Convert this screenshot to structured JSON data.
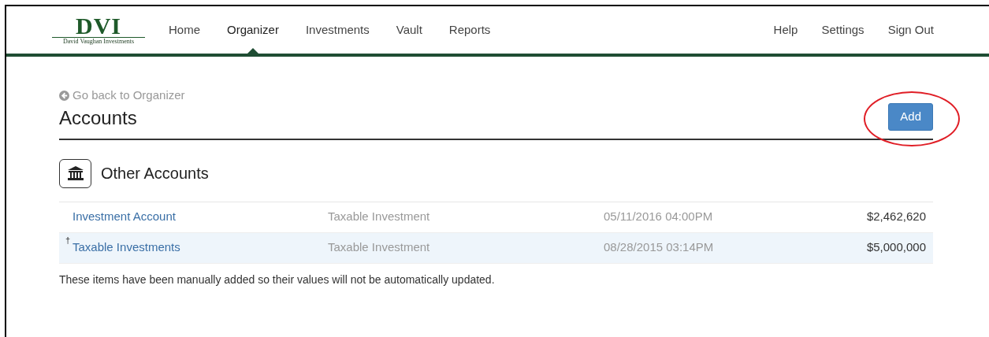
{
  "logo": {
    "title": "DVI",
    "subtitle": "David Vaughan Investments"
  },
  "nav": {
    "left": [
      {
        "label": "Home",
        "selected": false
      },
      {
        "label": "Organizer",
        "selected": true
      },
      {
        "label": "Investments",
        "selected": false
      },
      {
        "label": "Vault",
        "selected": false
      },
      {
        "label": "Reports",
        "selected": false
      }
    ],
    "right": [
      "Help",
      "Settings",
      "Sign Out"
    ]
  },
  "back_link": "Go back to Organizer",
  "page_title": "Accounts",
  "add_button": {
    "label": "Add",
    "circled": true
  },
  "section": {
    "title": "Other Accounts",
    "rows": [
      {
        "mark": "",
        "name": "Investment Account",
        "type": "Taxable Investment",
        "date": "05/11/2016 04:00PM",
        "value": "$2,462,620"
      },
      {
        "mark": "†",
        "name": "Taxable Investments",
        "type": "Taxable Investment",
        "date": "08/28/2015 03:14PM",
        "value": "$5,000,000"
      }
    ],
    "note": "These items have been manually added so their values will not be automatically updated."
  }
}
